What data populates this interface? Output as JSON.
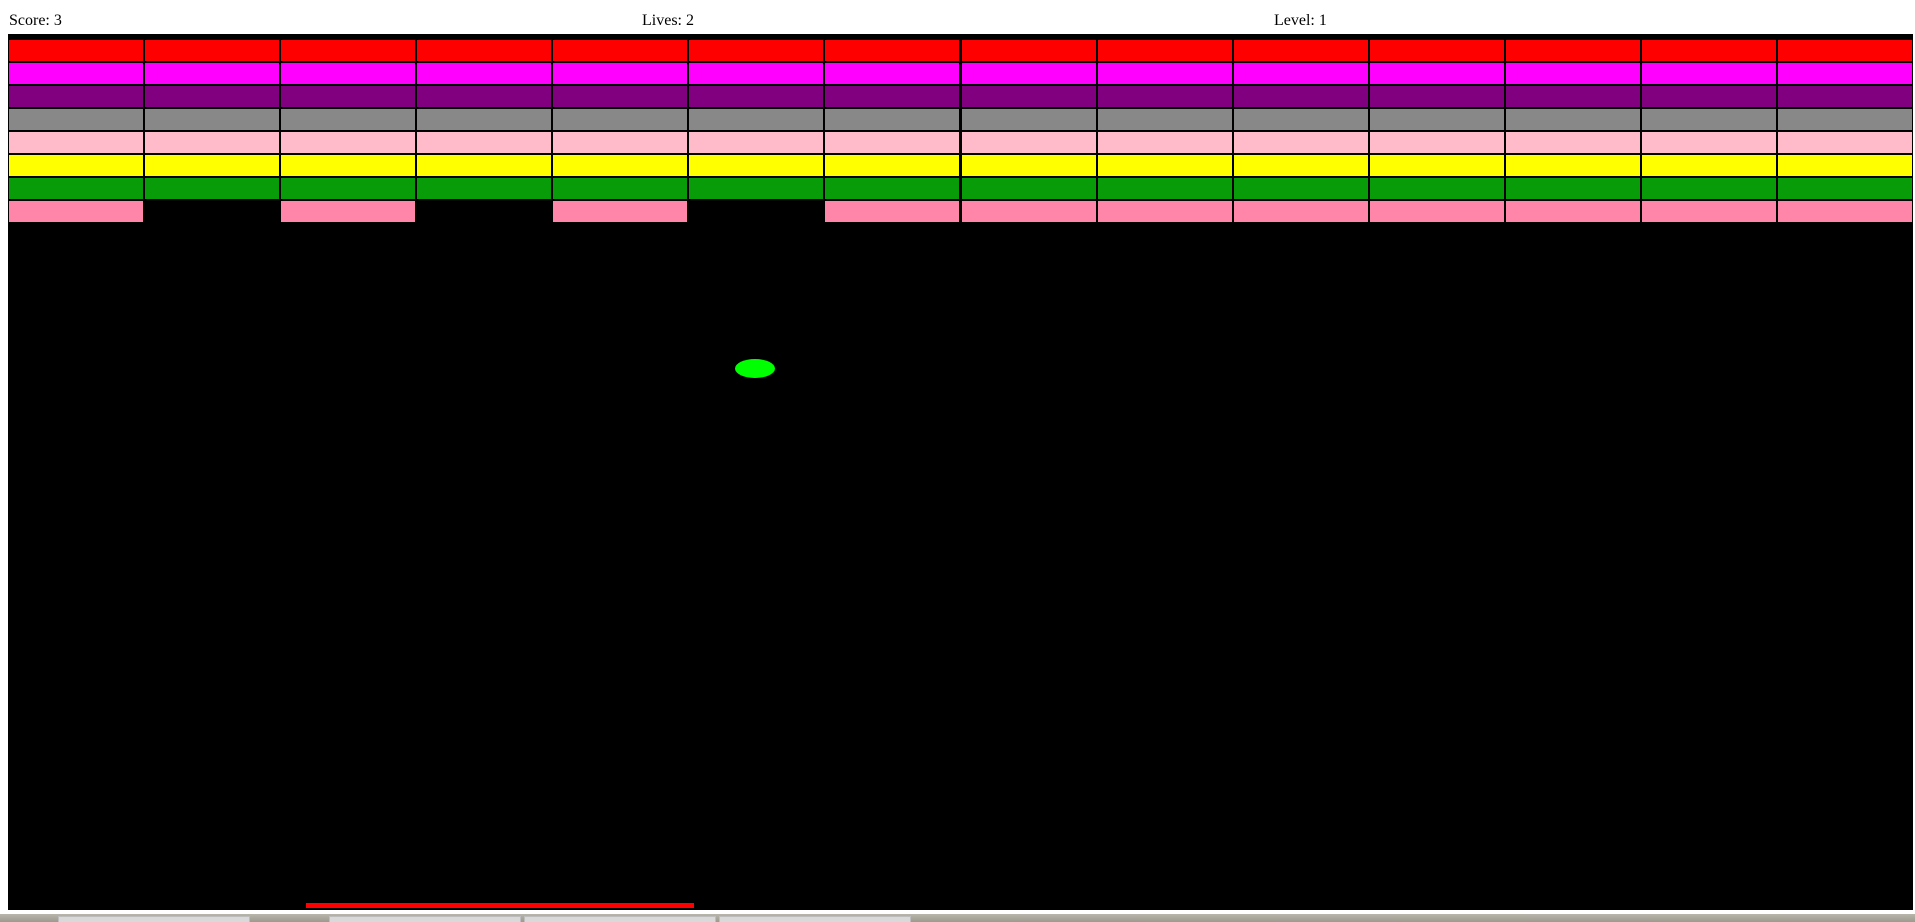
{
  "hud": {
    "score": "Score: 3",
    "lives": "Lives: 2",
    "level": "Level: 1"
  },
  "colors": {
    "canvas_bg": "#000000",
    "ball": "#00ff00",
    "paddle": "#ff0000",
    "brick_border": "#000000"
  },
  "bricks": {
    "columns": 14,
    "rows": [
      {
        "color": "#ff0000",
        "present": [
          1,
          1,
          1,
          1,
          1,
          1,
          1,
          1,
          1,
          1,
          1,
          1,
          1,
          1
        ]
      },
      {
        "color": "#ff00ff",
        "present": [
          1,
          1,
          1,
          1,
          1,
          1,
          1,
          1,
          1,
          1,
          1,
          1,
          1,
          1
        ]
      },
      {
        "color": "#800080",
        "present": [
          1,
          1,
          1,
          1,
          1,
          1,
          1,
          1,
          1,
          1,
          1,
          1,
          1,
          1
        ]
      },
      {
        "color": "#888888",
        "present": [
          1,
          1,
          1,
          1,
          1,
          1,
          1,
          1,
          1,
          1,
          1,
          1,
          1,
          1
        ]
      },
      {
        "color": "#ffbbc9",
        "present": [
          1,
          1,
          1,
          1,
          1,
          1,
          1,
          1,
          1,
          1,
          1,
          1,
          1,
          1
        ]
      },
      {
        "color": "#ffff00",
        "present": [
          1,
          1,
          1,
          1,
          1,
          1,
          1,
          1,
          1,
          1,
          1,
          1,
          1,
          1
        ]
      },
      {
        "color": "#089d08",
        "present": [
          1,
          1,
          1,
          1,
          1,
          1,
          1,
          1,
          1,
          1,
          1,
          1,
          1,
          1
        ]
      },
      {
        "color": "#ff85a9",
        "present": [
          1,
          0,
          1,
          0,
          1,
          0,
          1,
          1,
          1,
          1,
          1,
          1,
          1,
          1
        ]
      }
    ]
  }
}
